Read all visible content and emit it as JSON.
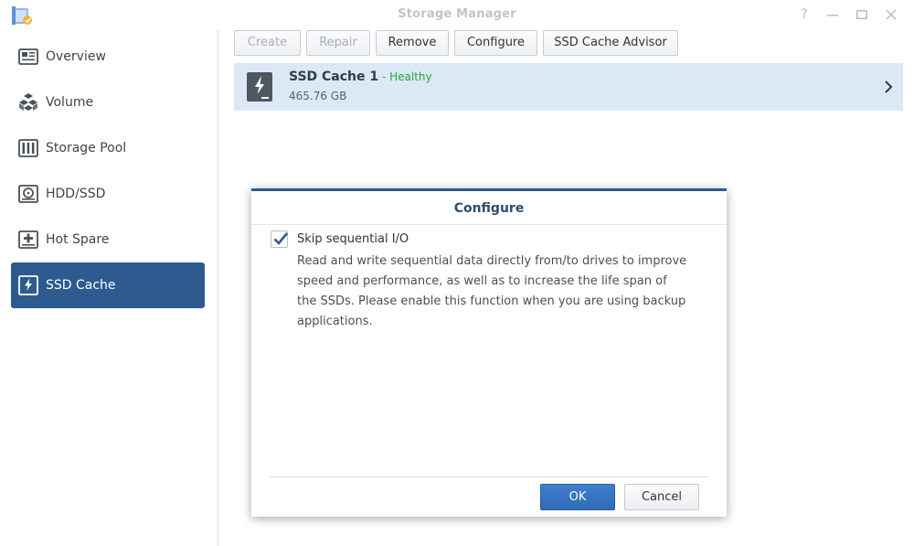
{
  "window": {
    "title": "Storage Manager",
    "controls": [
      "help-icon",
      "minimize-icon",
      "maximize-icon",
      "close-icon"
    ]
  },
  "sidebar": {
    "items": [
      {
        "label": "Overview",
        "icon": "overview-icon",
        "active": false
      },
      {
        "label": "Volume",
        "icon": "volume-icon",
        "active": false
      },
      {
        "label": "Storage Pool",
        "icon": "storage-pool-icon",
        "active": false
      },
      {
        "label": "HDD/SSD",
        "icon": "hdd-icon",
        "active": false
      },
      {
        "label": "Hot Spare",
        "icon": "hot-spare-icon",
        "active": false
      },
      {
        "label": "SSD Cache",
        "icon": "ssd-cache-icon",
        "active": true
      }
    ]
  },
  "toolbar": {
    "create": "Create",
    "repair": "Repair",
    "remove": "Remove",
    "configure": "Configure",
    "advisor": "SSD Cache Advisor",
    "disabled": [
      "Create",
      "Repair"
    ]
  },
  "cache": {
    "name": "SSD Cache 1",
    "separator": " - ",
    "status": "Healthy",
    "size": "465.76 GB"
  },
  "dialog": {
    "title": "Configure",
    "checkbox_label": "Skip sequential I/O",
    "checked": true,
    "description": "Read and write sequential data directly from/to drives to improve speed and performance, as well as to increase the life span of the SSDs. Please enable this function when you are using backup applications.",
    "ok": "OK",
    "cancel": "Cancel"
  },
  "colors": {
    "accent": "#2d5a8f",
    "selected_row": "#dbe9f7",
    "healthy": "#27a334",
    "primary_button": "#3276c3"
  }
}
